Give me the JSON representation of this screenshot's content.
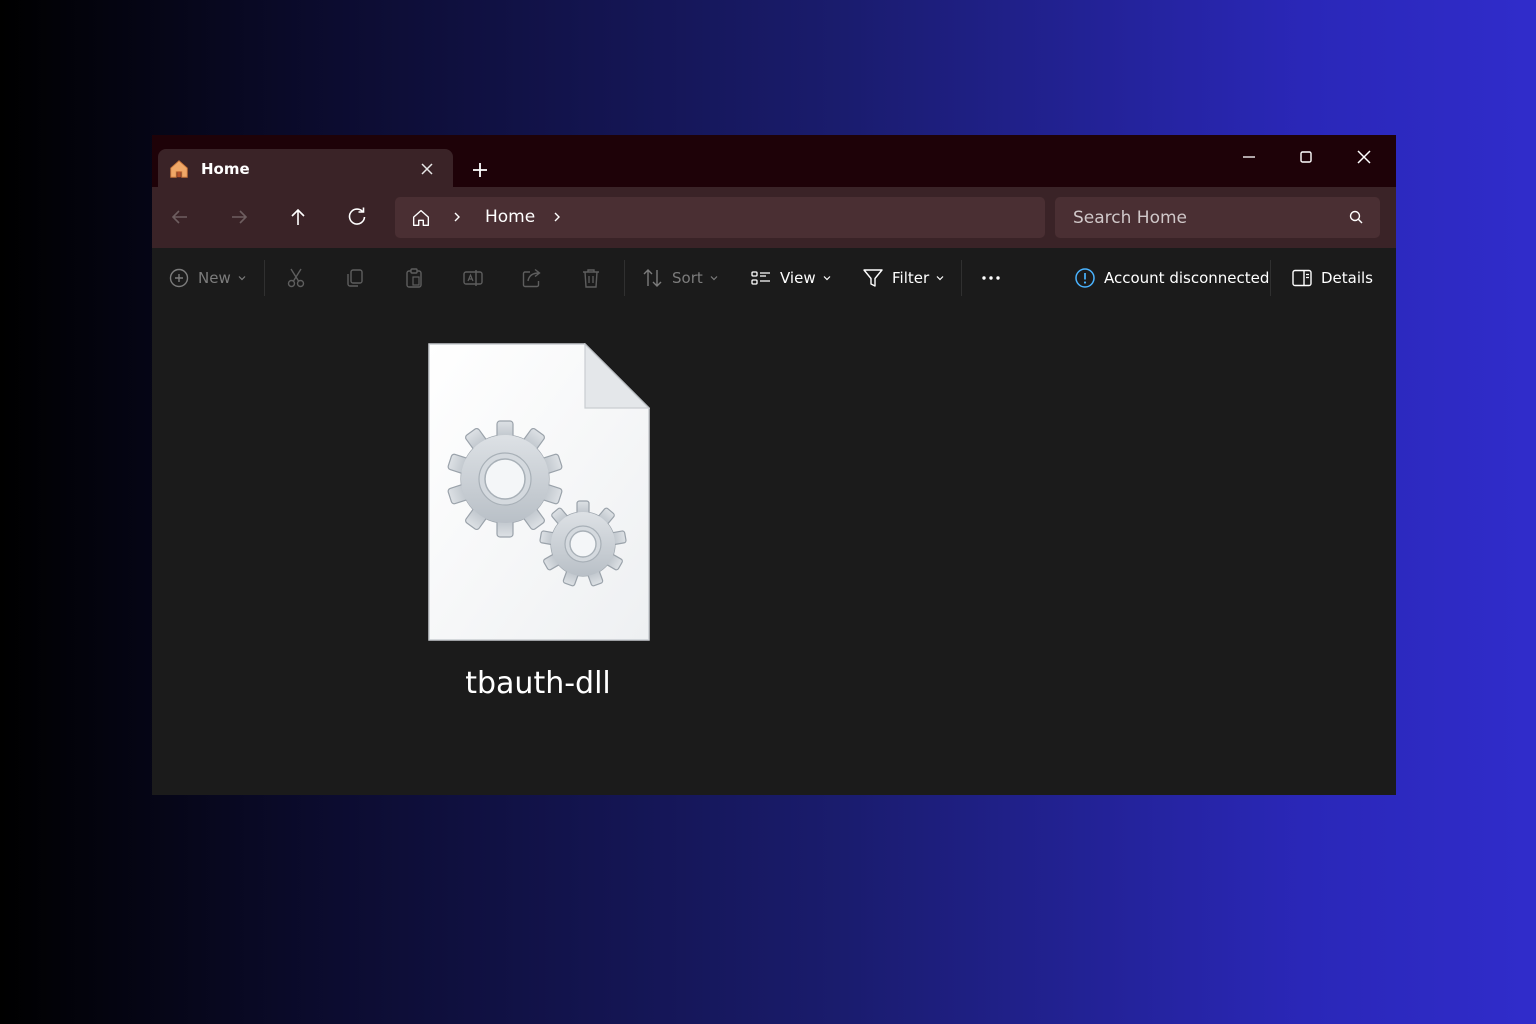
{
  "tabs": [
    {
      "label": "Home",
      "icon": "home-icon",
      "icon_color": "#f0a868"
    }
  ],
  "address": {
    "breadcrumb": [
      "Home"
    ]
  },
  "search": {
    "placeholder": "Search Home"
  },
  "commands": {
    "new_label": "New",
    "sort_label": "Sort",
    "view_label": "View",
    "filter_label": "Filter",
    "account_status": "Account disconnected",
    "details_label": "Details"
  },
  "files": [
    {
      "name": "tbauth-dll",
      "icon": "dll-file-icon"
    }
  ],
  "colors": {
    "titlebar": "#1e0208",
    "navbar": "#3a2327",
    "content_bg": "#1b1b1b",
    "accent_info": "#4ab3ff"
  }
}
